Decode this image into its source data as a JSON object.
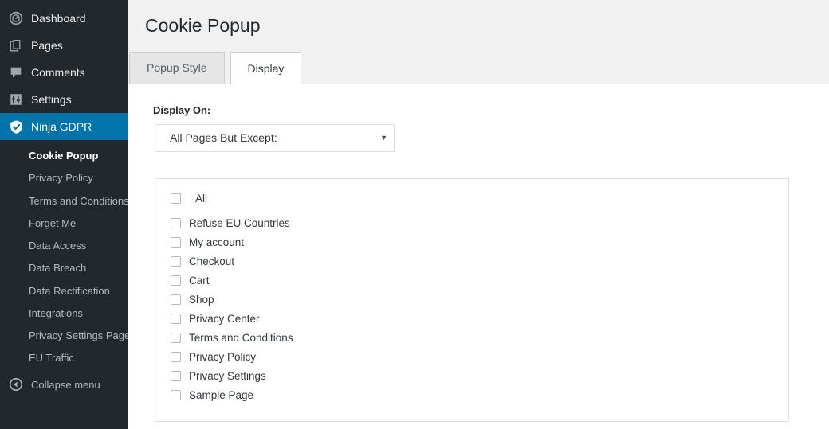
{
  "colors": {
    "sidebar_bg": "#23282d",
    "accent_blue": "#0073aa",
    "content_bg": "#f1f1f1",
    "panel_bg": "#ffffff",
    "border": "#cccccc"
  },
  "sidebar": {
    "top_items": [
      {
        "label": "Dashboard",
        "icon": "dashboard-icon",
        "current": false
      },
      {
        "label": "Pages",
        "icon": "pages-icon",
        "current": false
      },
      {
        "label": "Comments",
        "icon": "comments-icon",
        "current": false
      },
      {
        "label": "Settings",
        "icon": "settings-icon",
        "current": false
      },
      {
        "label": "Ninja GDPR",
        "icon": "shield-check-icon",
        "current": true
      }
    ],
    "submenu": [
      {
        "label": "Cookie Popup",
        "current": true
      },
      {
        "label": "Privacy Policy",
        "current": false
      },
      {
        "label": "Terms and Conditions",
        "current": false
      },
      {
        "label": "Forget Me",
        "current": false
      },
      {
        "label": "Data Access",
        "current": false
      },
      {
        "label": "Data Breach",
        "current": false
      },
      {
        "label": "Data Rectification",
        "current": false
      },
      {
        "label": "Integrations",
        "current": false
      },
      {
        "label": "Privacy Settings Page",
        "current": false
      },
      {
        "label": "EU Traffic",
        "current": false
      }
    ],
    "collapse": {
      "label": "Collapse menu",
      "icon": "collapse-left-arrow-icon"
    }
  },
  "main": {
    "page_title": "Cookie Popup",
    "tabs": [
      {
        "label": "Popup Style",
        "active": false
      },
      {
        "label": "Display",
        "active": true
      }
    ],
    "display_on": {
      "label": "Display On:",
      "selected": "All Pages But Except:",
      "arrow": "▼"
    },
    "page_list": [
      {
        "label": "All",
        "checked": false,
        "is_all": true
      },
      {
        "label": "Refuse EU Countries",
        "checked": false,
        "is_all": false
      },
      {
        "label": "My account",
        "checked": false,
        "is_all": false
      },
      {
        "label": "Checkout",
        "checked": false,
        "is_all": false
      },
      {
        "label": "Cart",
        "checked": false,
        "is_all": false
      },
      {
        "label": "Shop",
        "checked": false,
        "is_all": false
      },
      {
        "label": "Privacy Center",
        "checked": false,
        "is_all": false
      },
      {
        "label": "Terms and Conditions",
        "checked": false,
        "is_all": false
      },
      {
        "label": "Privacy Policy",
        "checked": false,
        "is_all": false
      },
      {
        "label": "Privacy Settings",
        "checked": false,
        "is_all": false
      },
      {
        "label": "Sample Page",
        "checked": false,
        "is_all": false
      }
    ]
  }
}
